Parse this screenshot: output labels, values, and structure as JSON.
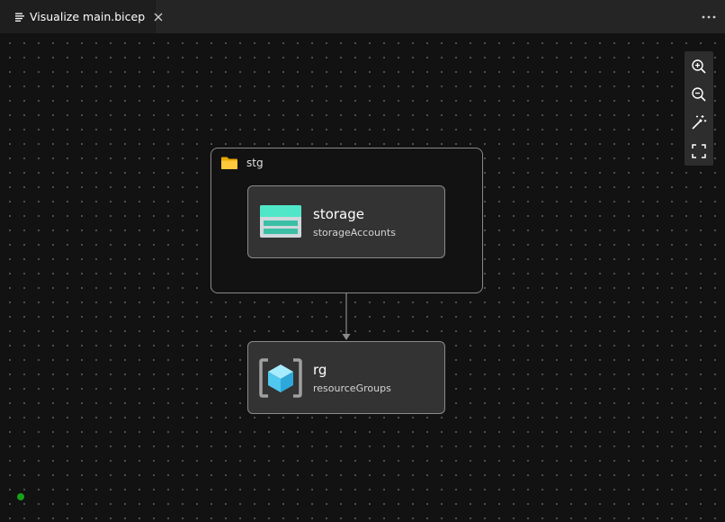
{
  "tab": {
    "label": "Visualize main.bicep",
    "icon": "preview-icon",
    "close_icon": "close-icon"
  },
  "header": {
    "more_icon": "ellipsis-icon"
  },
  "toolbar": {
    "tools": [
      {
        "name": "zoom-in",
        "icon": "zoom-in-icon"
      },
      {
        "name": "zoom-out",
        "icon": "zoom-out-icon"
      },
      {
        "name": "auto-layout",
        "icon": "magic-wand-icon"
      },
      {
        "name": "fit-to-screen",
        "icon": "fullscreen-icon"
      }
    ]
  },
  "graph": {
    "group": {
      "label": "stg",
      "icon": "folder-icon"
    },
    "nodes": [
      {
        "id": "storage",
        "title": "storage",
        "subtitle": "storageAccounts",
        "icon": "storage-account-icon"
      },
      {
        "id": "rg",
        "title": "rg",
        "subtitle": "resourceGroups",
        "icon": "resource-group-icon"
      }
    ]
  },
  "status": {
    "color": "#16a016"
  },
  "colors": {
    "accent_folder": "#ffc83d",
    "storage_teal": "#50e6c8",
    "cube_blue": "#50c8f0"
  }
}
